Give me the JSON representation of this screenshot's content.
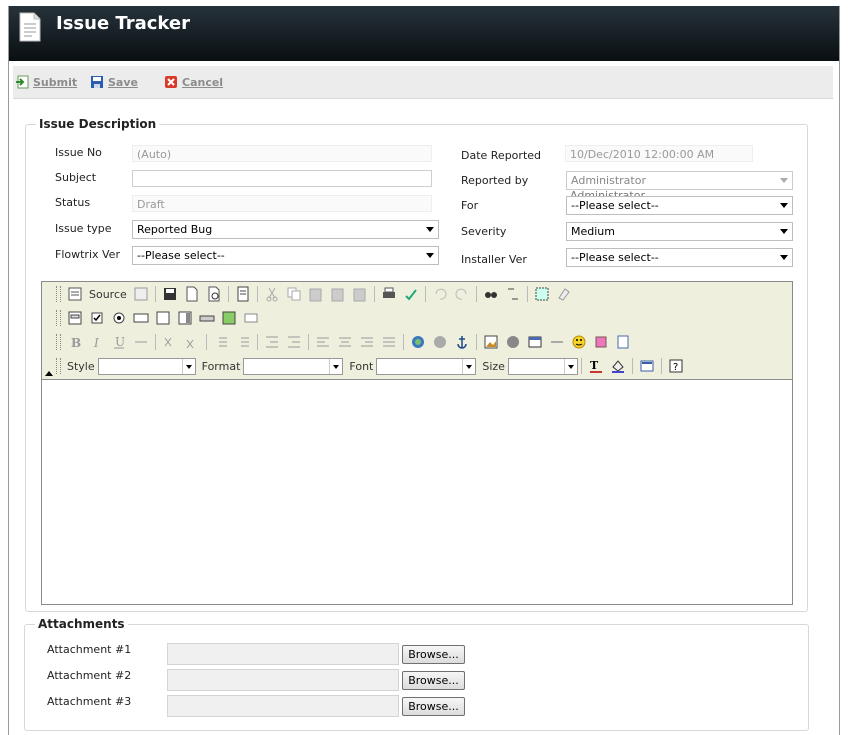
{
  "app": {
    "title": "Issue Tracker"
  },
  "toolbar": {
    "submit": "Submit",
    "save": "Save",
    "cancel": "Cancel"
  },
  "issue": {
    "legend": "Issue Description",
    "issue_no_label": "Issue No",
    "issue_no_value": "(Auto)",
    "subject_label": "Subject",
    "subject_value": "",
    "status_label": "Status",
    "status_value": "Draft",
    "issue_type_label": "Issue type",
    "issue_type_value": "Reported Bug",
    "flowtrix_label": "Flowtrix Ver",
    "flowtrix_value": "--Please select--",
    "date_label": "Date Reported",
    "date_value": "10/Dec/2010 12:00:00 AM",
    "reported_by_label": "Reported by",
    "reported_by_value": "Administrator",
    "reported_by_overflow": "Administrator",
    "for_label": "For",
    "for_value": "--Please select--",
    "severity_label": "Severity",
    "severity_value": "Medium",
    "installer_label": "Installer Ver",
    "installer_value": "--Please select--"
  },
  "editor": {
    "source_label": "Source",
    "style_label": "Style",
    "format_label": "Format",
    "font_label": "Font",
    "size_label": "Size",
    "content": ""
  },
  "attachments": {
    "legend": "Attachments",
    "items": [
      {
        "label": "Attachment #1",
        "button": "Browse..."
      },
      {
        "label": "Attachment #2",
        "button": "Browse..."
      },
      {
        "label": "Attachment #3",
        "button": "Browse..."
      }
    ]
  }
}
